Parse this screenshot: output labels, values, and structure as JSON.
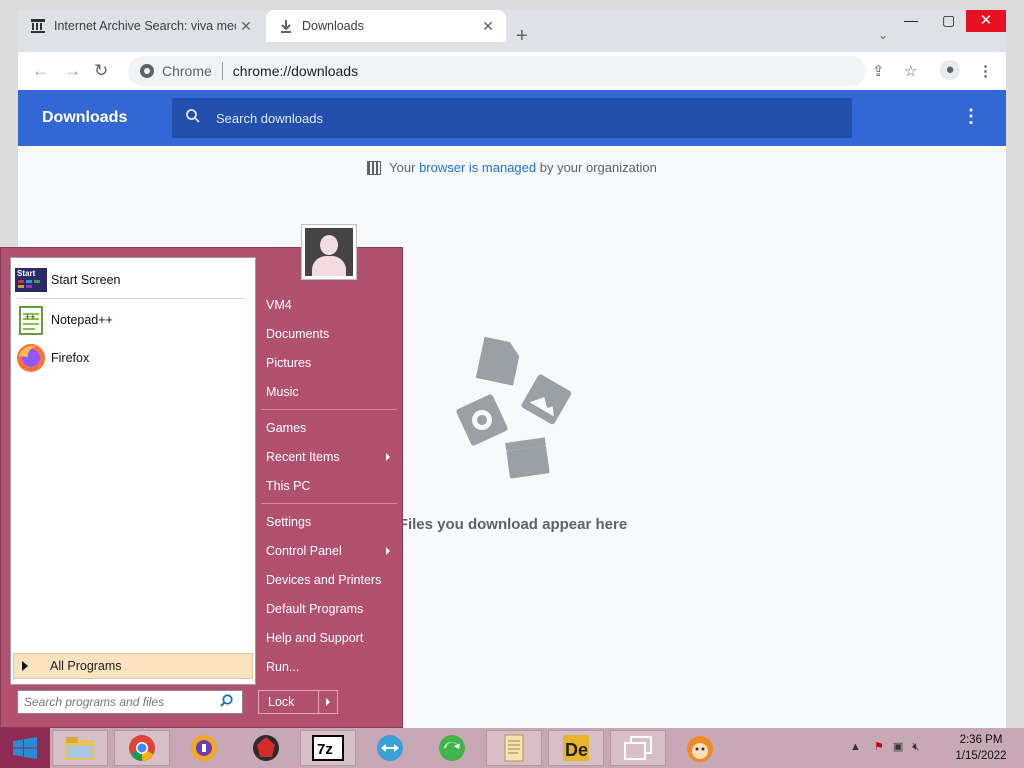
{
  "browser": {
    "tabs": [
      {
        "title": "Internet Archive Search: viva mec",
        "active": false
      },
      {
        "title": "Downloads",
        "active": true
      }
    ],
    "omnibox": {
      "site_label": "Chrome",
      "url": "chrome://downloads"
    }
  },
  "downloads_page": {
    "title": "Downloads",
    "search_placeholder": "Search downloads",
    "managed_prefix": "Your ",
    "managed_link": "browser is managed",
    "managed_suffix": " by your organization",
    "empty_message": "Files you download appear here"
  },
  "start_menu": {
    "pinned": [
      {
        "label": "Start Screen",
        "icon": "start-screen-icon"
      },
      {
        "label": "Notepad++",
        "icon": "notepadpp-icon"
      },
      {
        "label": "Firefox",
        "icon": "firefox-icon"
      }
    ],
    "all_programs": "All Programs",
    "search_placeholder": "Search programs and files",
    "right_items": [
      {
        "label": "VM4"
      },
      {
        "label": "Documents"
      },
      {
        "label": "Pictures"
      },
      {
        "label": "Music"
      },
      {
        "label": "Games"
      },
      {
        "label": "Recent Items",
        "submenu": true
      },
      {
        "label": "This PC"
      },
      {
        "label": "Settings"
      },
      {
        "label": "Control Panel",
        "submenu": true
      },
      {
        "label": "Devices and Printers"
      },
      {
        "label": "Default Programs"
      },
      {
        "label": "Help and Support"
      },
      {
        "label": "Run..."
      }
    ],
    "lock_label": "Lock"
  },
  "taskbar": {
    "apps": [
      "file-explorer-icon",
      "chrome-icon",
      "keepass-icon",
      "antivirus-icon",
      "7zip-icon",
      "teamviewer-icon",
      "green-refresh-icon",
      "notepad-scroll-icon",
      "dictionary-icon",
      "task-view-icon",
      "clementine-icon"
    ],
    "clock_time": "2:36 PM",
    "clock_date": "1/15/2022"
  }
}
